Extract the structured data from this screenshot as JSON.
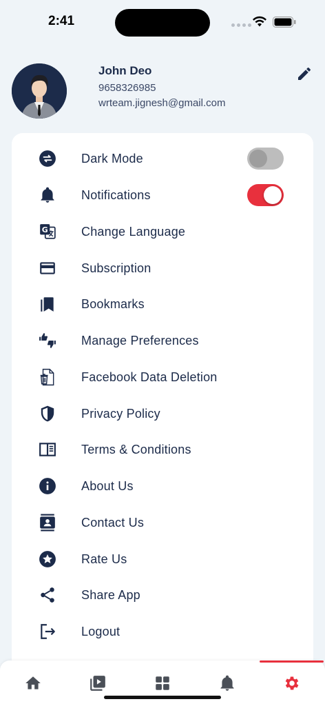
{
  "status_bar": {
    "time": "2:41"
  },
  "profile": {
    "name": "John Deo",
    "phone": "9658326985",
    "email": "wrteam.jignesh@gmail.com"
  },
  "menu": {
    "items": [
      {
        "label": "Dark Mode",
        "icon": "swap-icon",
        "toggle": "off"
      },
      {
        "label": "Notifications",
        "icon": "bell-icon",
        "toggle": "on"
      },
      {
        "label": "Change Language",
        "icon": "translate-icon"
      },
      {
        "label": "Subscription",
        "icon": "credit-card-icon"
      },
      {
        "label": "Bookmarks",
        "icon": "bookmarks-icon"
      },
      {
        "label": "Manage Preferences",
        "icon": "thumbs-icon"
      },
      {
        "label": "Facebook Data Deletion",
        "icon": "file-delete-icon"
      },
      {
        "label": "Privacy Policy",
        "icon": "shield-icon"
      },
      {
        "label": "Terms & Conditions",
        "icon": "book-icon"
      },
      {
        "label": "About Us",
        "icon": "info-icon"
      },
      {
        "label": "Contact Us",
        "icon": "contact-icon"
      },
      {
        "label": "Rate Us",
        "icon": "star-icon"
      },
      {
        "label": "Share App",
        "icon": "share-icon"
      },
      {
        "label": "Logout",
        "icon": "logout-icon"
      }
    ]
  },
  "bottom_nav": {
    "items": [
      "home-icon",
      "video-icon",
      "categories-icon",
      "bell-icon",
      "settings-icon"
    ],
    "active": "settings-icon"
  },
  "colors": {
    "primary": "#1c2b4a",
    "accent": "#e8303d",
    "background": "#eff4f8"
  }
}
